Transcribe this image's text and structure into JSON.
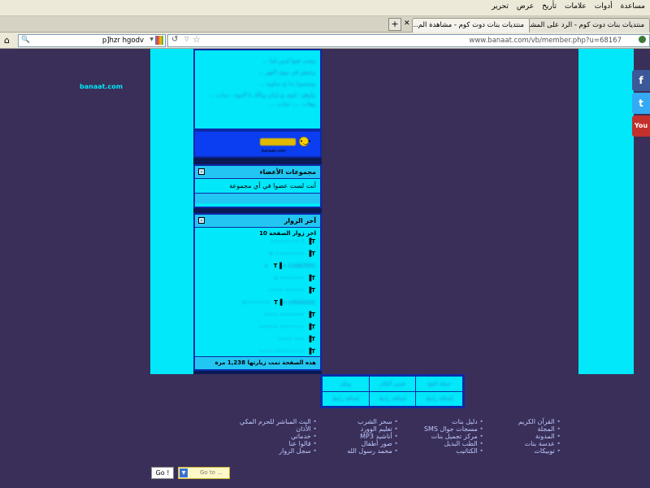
{
  "browser": {
    "menus": [
      "مساعدة",
      "أدوات",
      "علامات",
      "تأريخ",
      "عرض",
      "تحرير"
    ],
    "tabs": [
      {
        "label": "منتديات بنات دوت كوم - الرد على المشاركة"
      },
      {
        "label": "منتديات بنات دوت كوم - مشاهدة الم..."
      }
    ],
    "new_tab": "+",
    "search_value": "p]hzr hgodv",
    "url": "www.banaat.com/vb/member.php?u=68167"
  },
  "site": {
    "logo": "banaat.com",
    "top_panel": {
      "lines": [
        "وصب هيوا ليس لنيا ...",
        "وعيش في نيوى البهر ...",
        "ويسمويا بدا ي ساويه ...",
        "وأوهو : ليوم بو ابيان وبالك نا البنوه : ساب ...",
        "وهاب ....: ساب ...."
      ],
      "banner_caption": "banaat.com"
    },
    "groups_panel": {
      "title": "مجموعات الأعضاء",
      "text": "أنت لست عضوا في أي مجموعة",
      "collapse": "-"
    },
    "visitors_panel": {
      "title": "آخر الزوار",
      "subtitle": "اخر زوار الصفحة 10",
      "visitors": [
        "* ~~~~~~",
        "~~~~~~ +",
        "+ CABERRS +",
        "~~~~~ +",
        "~~~~ ~~~",
        "++Kkkkkkk~~~~~+",
        "~~~~~ ~~~",
        "~~~~~ ~~~~",
        "~~ ~~~",
        "~~~~~~ ~~~"
      ],
      "footer": "هذه الصفحة تمت زيارتها 1,238 مرة",
      "collapse": "-"
    },
    "bottom_nav": [
      [
        "حملة الفخ",
        "فيس أفكار",
        "ونكر"
      ],
      [
        "إضافة رابط",
        "إضافة رابط",
        "إضافة رابط"
      ]
    ],
    "link_columns": [
      [
        "القرآن الكريم",
        "المجلة",
        "المدونة",
        "عدسة بنات",
        "توبيكات"
      ],
      [
        "دليل بنات",
        "مسجات جوال SMS",
        "مركز تجميل بنات",
        "الطب البديل",
        "الكتاتيب"
      ],
      [
        "سحر الشرب",
        "تعليم الوورد",
        "أناشيد MP3",
        "صور أطفال",
        "محمد رسول الله"
      ],
      [
        "البث المباشر للحرم المكي",
        "الأذان",
        "خدماتي",
        "قالوا عنا",
        "سجل الزوار"
      ]
    ],
    "go_button": "Go !",
    "go_to_placeholder": "Go to ..."
  },
  "colors": {
    "background": "#3a2f58",
    "cyan": "#00e8fa",
    "blue": "#0c2aa8"
  }
}
